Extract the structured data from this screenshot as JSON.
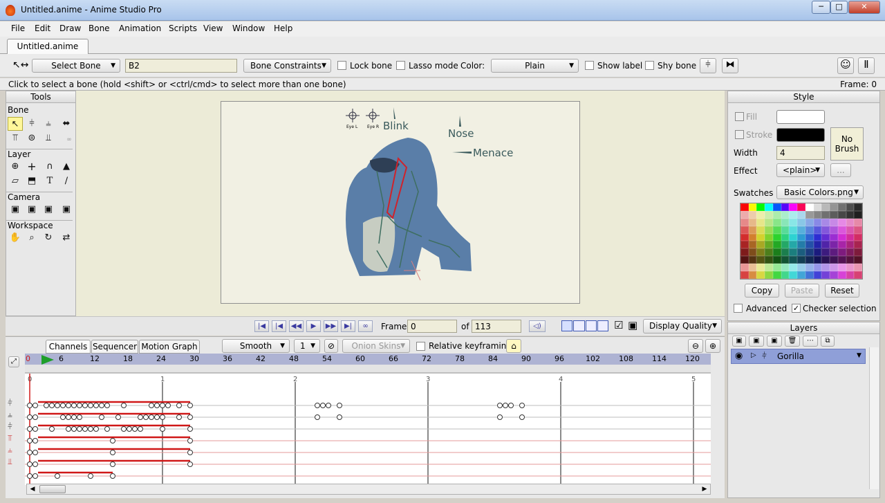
{
  "window": {
    "title": "Untitled.anime - Anime Studio Pro",
    "min": "─",
    "max": "□",
    "close": "✕"
  },
  "menu": [
    "File",
    "Edit",
    "Draw",
    "Bone",
    "Animation",
    "Scripts",
    "View",
    "Window",
    "Help"
  ],
  "doc_tab": "Untitled.anime",
  "toolbar": {
    "select_bone": "Select Bone",
    "bone_name": "B2",
    "bone_constraints": "Bone Constraints",
    "lock_bone": "Lock bone",
    "lasso_mode": "Lasso mode",
    "color_label": "Color:",
    "color_value": "Plain",
    "show_label": "Show label",
    "shy_bone": "Shy bone"
  },
  "status": {
    "hint": "Click to select a bone (hold <shift> or <ctrl/cmd> to select more than one bone)",
    "frame": "Frame: 0"
  },
  "tools": {
    "title": "Tools",
    "sections": [
      "Bone",
      "Layer",
      "Camera",
      "Workspace"
    ],
    "layer_text_tool": "T"
  },
  "canvas_labels": {
    "blink": "Blink",
    "nose": "Nose",
    "menace": "Menace",
    "eye_l": "Eye L",
    "eye_r": "Eye R"
  },
  "playback": {
    "frame_label": "Frame",
    "frame_value": "0",
    "of_label": "of",
    "total": "113",
    "display_quality": "Display Quality"
  },
  "timeline": {
    "tabs": [
      "Channels",
      "Sequencer",
      "Motion Graph"
    ],
    "interp": "Smooth",
    "interval": "1",
    "onion": "Onion Skins",
    "relative": "Relative keyframing",
    "ruler": [
      "0",
      "6",
      "12",
      "18",
      "24",
      "30",
      "36",
      "42",
      "48",
      "54",
      "60",
      "66",
      "72",
      "78",
      "84",
      "90",
      "96",
      "102",
      "108",
      "114",
      "120"
    ],
    "seconds": [
      "0",
      "1",
      "2",
      "3",
      "4",
      "5"
    ],
    "tracks": [
      [
        0,
        1,
        3,
        4,
        5,
        6,
        7,
        8,
        9,
        10,
        11,
        12,
        13,
        14,
        17,
        22,
        23,
        24,
        25,
        27,
        29,
        52,
        53,
        54,
        56,
        85,
        86,
        87,
        89
      ],
      [
        0,
        1,
        6,
        7,
        8,
        9,
        13,
        16,
        20,
        21,
        22,
        23,
        24,
        27,
        29,
        52,
        56,
        85,
        89
      ],
      [
        0,
        1,
        4,
        7,
        8,
        9,
        10,
        11,
        12,
        14,
        17,
        18,
        19,
        20,
        24,
        29
      ],
      [
        0,
        1,
        15,
        29
      ],
      [
        0,
        1,
        15,
        29
      ],
      [
        0,
        1,
        15,
        29
      ],
      [
        0,
        1,
        5,
        11,
        15
      ]
    ]
  },
  "style": {
    "title": "Style",
    "fill": "Fill",
    "stroke": "Stroke",
    "width_label": "Width",
    "width_value": "4",
    "no_brush": "No Brush",
    "effect_label": "Effect",
    "effect_value": "<plain>",
    "more": "...",
    "swatches_label": "Swatches",
    "swatches_value": "Basic Colors.png",
    "copy": "Copy",
    "paste": "Paste",
    "reset": "Reset",
    "advanced": "Advanced",
    "checker": "Checker selection"
  },
  "layers": {
    "title": "Layers",
    "items": [
      {
        "name": "Gorilla"
      }
    ]
  },
  "colors": {
    "accent": "#5f74c4",
    "keyline": "#d01818",
    "ruler": "#aeb3d3"
  }
}
